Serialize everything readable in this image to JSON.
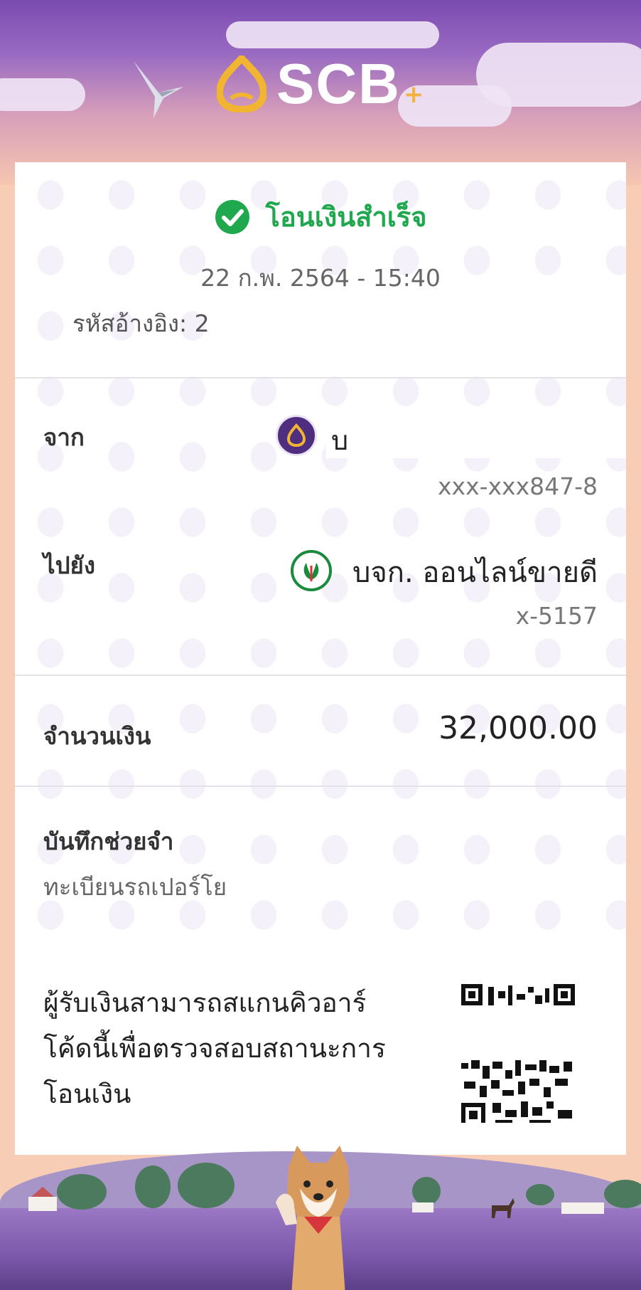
{
  "header": {
    "brand_text": "SCB",
    "brand_plus": "+"
  },
  "status": {
    "title": "โอนเงินสำเร็จ",
    "datetime": "22 ก.พ. 2564 - 15:40",
    "ref_label": "รหัสอ้างอิง: 2"
  },
  "from": {
    "label": "จาก",
    "name_partial": "บ",
    "account": "xxx-xxx847-8",
    "bank_icon": "scb-bank-icon"
  },
  "to": {
    "label": "ไปยัง",
    "name": "บจก. ออนไลน์ขายดี",
    "account": "x-5157",
    "bank_icon": "kbank-icon"
  },
  "amount": {
    "label": "จำนวนเงิน",
    "value": "32,000.00"
  },
  "memo": {
    "label": "บันทึกช่วยจำ",
    "value": "ทะเบียนรถเปอร์โย"
  },
  "qr": {
    "text": "ผู้รับเงินสามารถสแกนคิวอาร์โค้ดนี้เพื่อตรวจสอบสถานะการโอนเงิน"
  },
  "colors": {
    "success": "#1fa84d",
    "scb_purple": "#4f2d7f",
    "kbank_green": "#1a8a3d"
  }
}
